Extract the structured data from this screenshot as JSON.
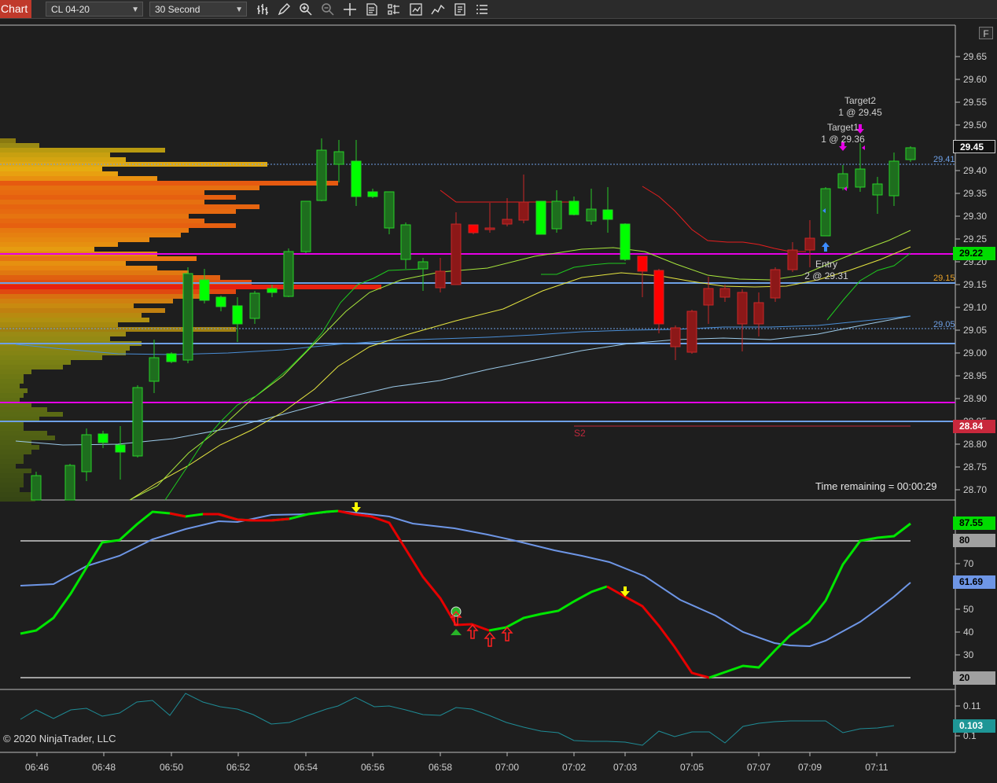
{
  "toolbar": {
    "tab_label": "Chart",
    "instrument": "CL 04-20",
    "interval": "30 Second",
    "icons": [
      "bars-type-icon",
      "pencil-icon",
      "zoom-in-icon",
      "zoom-out-icon",
      "crosshair-icon",
      "data-box-icon",
      "properties-icon",
      "strategies-icon",
      "indicators-icon",
      "templates-icon",
      "list-icon"
    ]
  },
  "price_axis": {
    "ticks": [
      "29.65",
      "29.60",
      "29.55",
      "29.50",
      "29.45",
      "29.40",
      "29.35",
      "29.30",
      "29.25",
      "29.20",
      "29.15",
      "29.10",
      "29.05",
      "29.00",
      "28.95",
      "28.90",
      "28.85",
      "28.80",
      "28.75",
      "28.70"
    ],
    "last_price": "29.45",
    "level_22": "29.22",
    "level_84": "28.84"
  },
  "line_labels": {
    "l41": "29.41",
    "l15": "29.15",
    "l05": "29.05",
    "s2": "S2"
  },
  "orders": {
    "target2_name": "Target2",
    "target2_qty": "1 @ 29.45",
    "target1_name": "Target1",
    "target1_qty": "1 @ 29.36",
    "entry_name": "Entry",
    "entry_qty": "2 @ 29.31"
  },
  "time_remaining": "Time remaining = 00:00:29",
  "osc_axis": {
    "ticks": [
      "70",
      "50",
      "40",
      "30"
    ],
    "value_green": "87.55",
    "value_blue": "61.69",
    "level_high": "80",
    "level_low": "20"
  },
  "lower_axis": {
    "ticks": [
      "0.11",
      "0.1"
    ],
    "value": "0.103"
  },
  "time_axis": [
    "06:46",
    "06:48",
    "06:50",
    "06:52",
    "06:54",
    "06:56",
    "06:58",
    "07:00",
    "07:02",
    "07:03",
    "07:05",
    "07:07",
    "07:09",
    "07:11"
  ],
  "copyright": "© 2020 NinjaTrader, LLC",
  "f_button": "F",
  "colors": {
    "bg": "#1e1e1e",
    "up": "#00e600",
    "down": "#e60000",
    "magenta": "#e600e6",
    "steel": "#6ea0e6"
  }
}
